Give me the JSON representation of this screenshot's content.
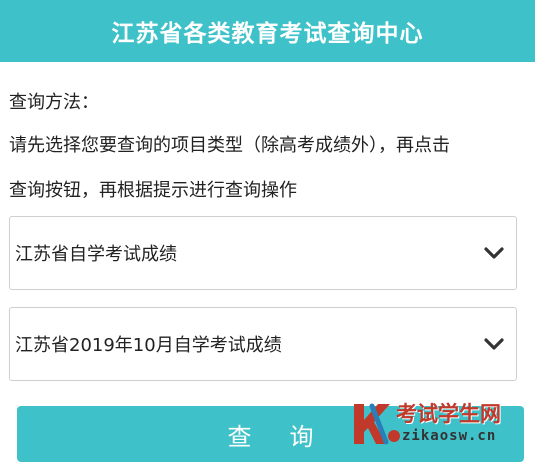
{
  "header": {
    "title": "江苏省各类教育考试查询中心"
  },
  "instructions": {
    "line1": "查询方法：",
    "line2": "请先选择您要查询的项目类型（除高考成绩外），再点击",
    "line3": "查询按钮，再根据提示进行查询操作"
  },
  "selects": {
    "category": {
      "selected": "江苏省自学考试成绩"
    },
    "exam": {
      "selected": "江苏省2019年10月自学考试成绩"
    }
  },
  "query_button": {
    "label": "查询"
  },
  "watermark": {
    "title": "考试学生网",
    "url": "zikaosw.cn"
  },
  "colors": {
    "accent": "#3fc1c9",
    "watermark_red": "#c0392b"
  },
  "icons": {
    "select_arrow": "chevron-down-icon",
    "watermark_logo": "k-logo-icon"
  }
}
